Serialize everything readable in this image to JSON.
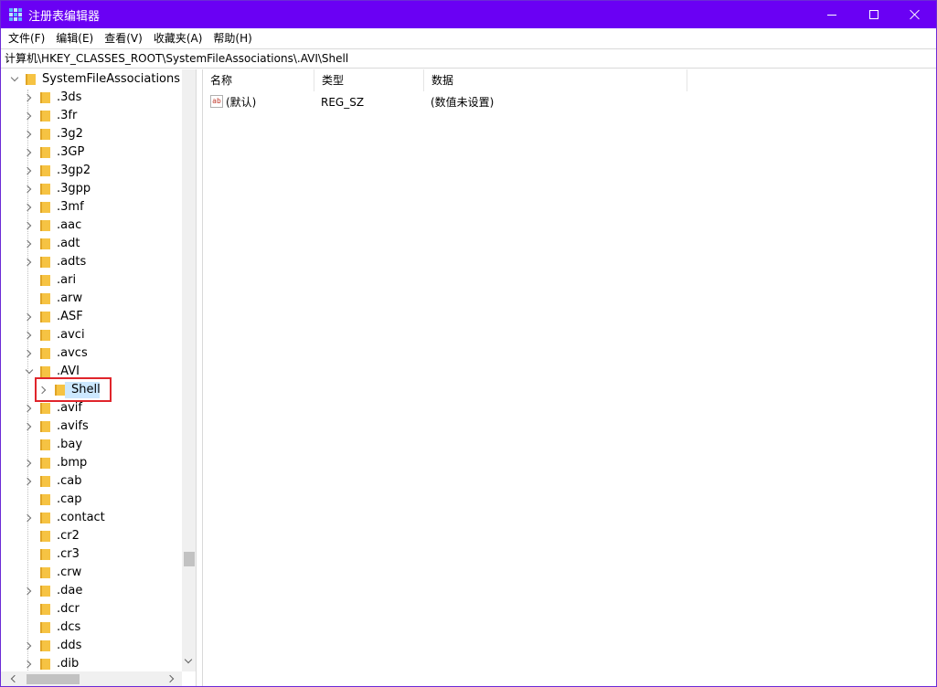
{
  "window": {
    "title": "注册表编辑器",
    "accent": "#6a00f4"
  },
  "menu": {
    "items": [
      "文件(F)",
      "编辑(E)",
      "查看(V)",
      "收藏夹(A)",
      "帮助(H)"
    ]
  },
  "address": {
    "path": "计算机\\HKEY_CLASSES_ROOT\\SystemFileAssociations\\.AVI\\Shell"
  },
  "tree": {
    "root": "SystemFileAssociations",
    "nodes": [
      ".3ds",
      ".3fr",
      ".3g2",
      ".3GP",
      ".3gp2",
      ".3gpp",
      ".3mf",
      ".aac",
      ".adt",
      ".adts",
      ".ari",
      ".arw",
      ".ASF",
      ".avci",
      ".avcs",
      ".AVI",
      "Shell",
      ".avif",
      ".avifs",
      ".bay",
      ".bmp",
      ".cab",
      ".cap",
      ".contact",
      ".cr2",
      ".cr3",
      ".crw",
      ".dae",
      ".dcr",
      ".dcs",
      ".dds",
      ".dib"
    ],
    "selected": "Shell"
  },
  "values": {
    "headers": {
      "name": "名称",
      "type": "类型",
      "data": "数据"
    },
    "rows": [
      {
        "icon": "string-value-icon",
        "name": "(默认)",
        "type": "REG_SZ",
        "data": "(数值未设置)"
      }
    ]
  }
}
